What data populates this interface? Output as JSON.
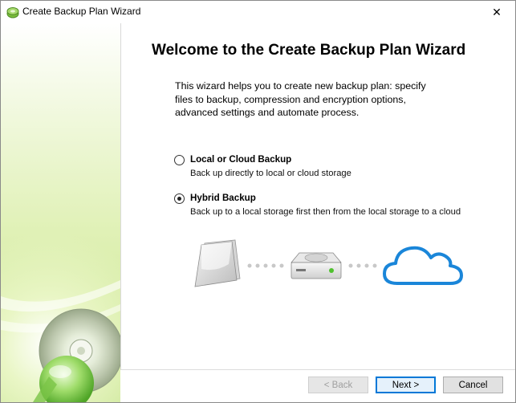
{
  "window": {
    "title": "Create Backup Plan Wizard",
    "close_glyph": "✕"
  },
  "content": {
    "heading": "Welcome to the Create Backup Plan Wizard",
    "intro_lines": [
      "This wizard helps you to create new backup plan: specify",
      "files to backup, compression and encryption options,",
      "advanced settings and automate process."
    ],
    "options": [
      {
        "label": "Local or Cloud Backup",
        "description": "Back up directly to local or cloud storage",
        "selected": false
      },
      {
        "label": "Hybrid Backup",
        "description": "Back up to a local storage first then from the local storage to a cloud",
        "selected": true
      }
    ]
  },
  "diagram": {
    "icons": [
      "documents-icon",
      "hard-drive-icon",
      "cloud-icon"
    ]
  },
  "buttons": {
    "back": "< Back",
    "next": "Next >",
    "cancel": "Cancel"
  },
  "colors": {
    "accent": "#0078d7",
    "cloud": "#1a86d9",
    "panel_green": "#d3eaa0"
  }
}
